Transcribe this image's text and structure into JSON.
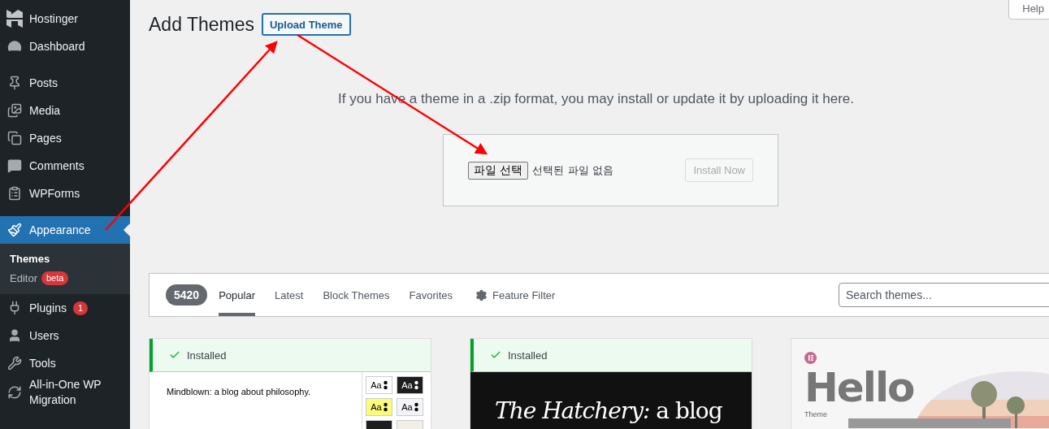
{
  "sidebar": {
    "groups": [
      [
        {
          "label": "Hostinger",
          "selected": false
        },
        {
          "label": "Dashboard",
          "selected": false
        }
      ],
      [
        {
          "label": "Posts",
          "selected": false
        },
        {
          "label": "Media",
          "selected": false
        },
        {
          "label": "Pages",
          "selected": false
        },
        {
          "label": "Comments",
          "selected": false
        },
        {
          "label": "WPForms",
          "selected": false
        }
      ],
      [
        {
          "label": "Appearance",
          "selected": true,
          "children": [
            {
              "label": "Themes",
              "selected": true
            },
            {
              "label": "Editor",
              "selected": false,
              "badge": "beta"
            }
          ]
        },
        {
          "label": "Plugins",
          "selected": false,
          "badge": "1"
        },
        {
          "label": "Users",
          "selected": false
        },
        {
          "label": "Tools",
          "selected": false
        },
        {
          "label": "All-in-One WP Migration",
          "selected": false
        }
      ]
    ]
  },
  "header": {
    "title": "Add Themes",
    "upload_button": "Upload Theme",
    "help_tab": "Help"
  },
  "upload": {
    "description": "If you have a theme in a .zip format, you may install or update it by uploading it here.",
    "file_button": "파일 선택",
    "file_status": "선택된 파일 없음",
    "install_button": {
      "label": "Install Now",
      "disabled": true
    }
  },
  "filter": {
    "count": "5420",
    "tabs": [
      {
        "label": "Popular",
        "selected": true
      },
      {
        "label": "Latest",
        "selected": false
      },
      {
        "label": "Block Themes",
        "selected": false
      },
      {
        "label": "Favorites",
        "selected": false
      }
    ],
    "feature_filter": "Feature Filter",
    "search": {
      "placeholder": "Search themes..."
    }
  },
  "themes": [
    {
      "installed": true,
      "status": "Installed",
      "preview": {
        "kind": "swatches",
        "tagline": "Mindblown: a blog about philosophy.",
        "swatches": [
          {
            "label": "Aa",
            "color": "#ffffff"
          },
          {
            "label": "Aa",
            "color": "#1e1e1e"
          },
          {
            "label": "Aa",
            "color": "#fbfb7c"
          },
          {
            "label": "Aa",
            "color": "#f3f3f8"
          },
          {
            "color": "#1e1e1e"
          },
          {
            "color": "#f3eee6"
          }
        ]
      }
    },
    {
      "installed": true,
      "status": "Installed",
      "preview": {
        "kind": "dark",
        "title": "*The Hatchery:* a blog"
      }
    },
    {
      "installed": false,
      "preview": {
        "kind": "hello",
        "title": "Hello",
        "subtitle": "Theme"
      }
    }
  ]
}
